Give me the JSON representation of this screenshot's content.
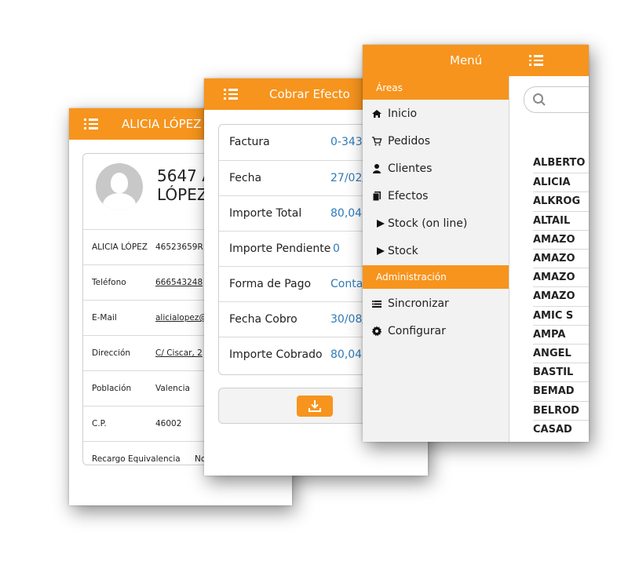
{
  "colors": {
    "accent": "#f7941d",
    "value_blue": "#2f7ab8"
  },
  "customer_screen": {
    "title": "ALICIA LÓPEZ",
    "header_name": "5647 A",
    "header_name_line2": "LÓPEZ",
    "rows": [
      {
        "key": "ALICIA LÓPEZ",
        "value": "46523659R"
      },
      {
        "key": "Teléfono",
        "value": "666543248"
      },
      {
        "key": "E-Mail",
        "value": "alicialopez@"
      },
      {
        "key": "Dirección",
        "value": "C/ Ciscar, 2"
      },
      {
        "key": "Población",
        "value": "Valencia"
      },
      {
        "key": "C.P.",
        "value": "46002"
      },
      {
        "key": "Recargo Equivalencia",
        "value": "No"
      }
    ]
  },
  "payment_screen": {
    "title": "Cobrar Efecto",
    "rows": [
      {
        "key": "Factura",
        "value": "0-343"
      },
      {
        "key": "Fecha",
        "value": "27/02/"
      },
      {
        "key": "Importe Total",
        "value": "80,04"
      },
      {
        "key": "Importe Pendiente",
        "value": "0"
      },
      {
        "key": "Forma de Pago",
        "value": "Conta"
      },
      {
        "key": "Fecha Cobro",
        "value": "30/08/"
      },
      {
        "key": "Importe Cobrado",
        "value": "80,04"
      }
    ],
    "download_icon": "download-icon"
  },
  "menu_screen": {
    "title": "Menú",
    "areas_label": "Áreas",
    "admin_label": "Administración",
    "areas": [
      {
        "label": "Inicio",
        "icon": "home-icon"
      },
      {
        "label": "Pedidos",
        "icon": "cart-icon"
      },
      {
        "label": "Clientes",
        "icon": "person-icon"
      },
      {
        "label": "Efectos",
        "icon": "document-icon"
      },
      {
        "label": "Stock (on line)",
        "icon": "play-icon"
      },
      {
        "label": "Stock",
        "icon": "play-icon"
      }
    ],
    "admin": [
      {
        "label": "Sincronizar",
        "icon": "sync-icon"
      },
      {
        "label": "Configurar",
        "icon": "gear-icon"
      }
    ],
    "list_items": [
      "ALBERTO",
      "ALICIA",
      "ALKROG",
      "ALTAIL",
      "AMAZO",
      "AMAZO",
      "AMAZO",
      "AMAZO",
      "AMIC S",
      "AMPA",
      "ANGEL",
      "BASTIL",
      "BEMAD",
      "BELROD",
      "CASAD"
    ]
  }
}
